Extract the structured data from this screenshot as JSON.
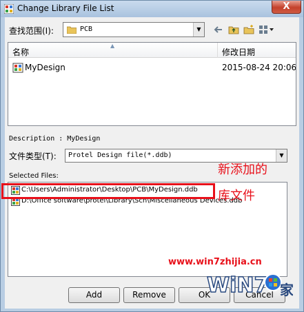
{
  "window": {
    "title": "Change Library File List",
    "close_symbol": "X"
  },
  "toolbar": {
    "look_in_label": "查找范围(I):",
    "look_in_value": "PCB",
    "back_icon": "back-arrow-icon",
    "up_icon": "up-folder-icon",
    "new_folder_icon": "new-folder-icon",
    "view_icon": "view-menu-icon"
  },
  "file_list": {
    "columns": [
      "名称",
      "修改日期"
    ],
    "rows": [
      {
        "name": "MyDesign",
        "date": "2015-08-24 20:06"
      }
    ]
  },
  "description": "Description : MyDesign",
  "file_type": {
    "label": "文件类型(T):",
    "value": "Protel Design file(*.ddb)"
  },
  "selected_files": {
    "label": "Selected Files:",
    "items": [
      "C:\\Users\\Administrator\\Desktop\\PCB\\MyDesign.ddb",
      "D:\\Office software\\protel\\Library\\Sch\\Miscellaneous Devices.ddb"
    ]
  },
  "buttons": {
    "add": "Add",
    "remove": "Remove",
    "ok": "OK",
    "cancel": "Cancel"
  },
  "annotation": {
    "line1": "新添加的",
    "line2": "库文件",
    "color": "#e8101a"
  },
  "watermark": {
    "url": "www.win7zhijia.cn"
  }
}
